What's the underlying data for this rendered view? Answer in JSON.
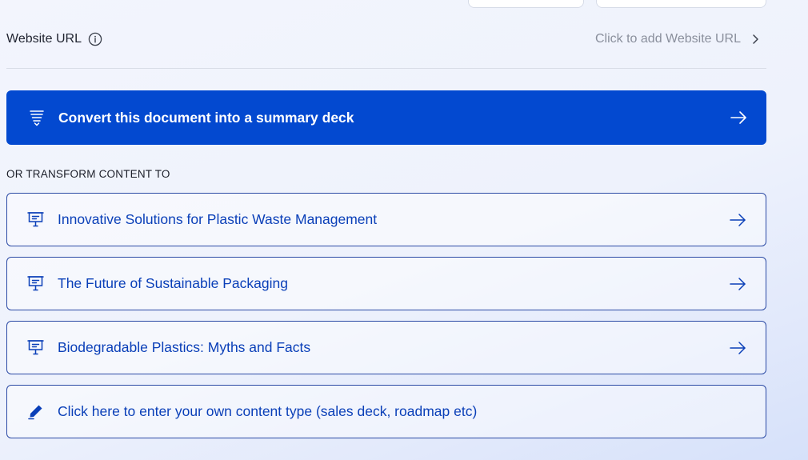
{
  "website_url": {
    "label": "Website URL",
    "info_icon": "info-icon",
    "add_text": "Click to add Website URL",
    "chevron_icon": "chevron-right-icon"
  },
  "primary_action": {
    "label": "Convert this document into a summary deck",
    "icon": "summary-lines-icon",
    "arrow_icon": "arrow-right-icon",
    "color": "#0349d0"
  },
  "transform": {
    "section_title": "OR TRANSFORM CONTENT TO",
    "options": [
      {
        "label": "Innovative Solutions for Plastic Waste Management",
        "icon": "presentation-icon"
      },
      {
        "label": "The Future of Sustainable Packaging",
        "icon": "presentation-icon"
      },
      {
        "label": "Biodegradable Plastics: Myths and Facts",
        "icon": "presentation-icon"
      }
    ],
    "custom_option": {
      "label": "Click here to enter your own content type (sales deck, roadmap etc)",
      "icon": "pencil-icon"
    },
    "accent_color": "#0a3fb8"
  }
}
